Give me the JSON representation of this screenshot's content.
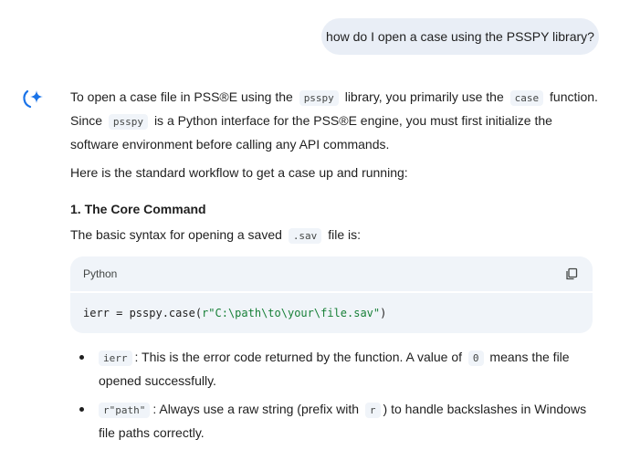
{
  "user_message": "how do I open a case using the PSSPY library?",
  "answer": {
    "intro": {
      "t1": "To open a case file in PSS®E using the",
      "c1": "psspy",
      "t2": "library, you primarily use the",
      "c2": "case",
      "t3": "function. Since",
      "c3": "psspy",
      "t4": "is a Python interface for the PSS®E engine, you must first initialize the software environment before calling any API commands."
    },
    "workflow": "Here is the standard workflow to get a case up and running:",
    "heading": "1. The Core Command",
    "syntax": {
      "t1": "The basic syntax for opening a saved",
      "c1": ".sav",
      "t2": "file is:"
    },
    "codeblock": {
      "language": "Python",
      "code_prefix": "ierr = psspy.case(",
      "code_string": "r\"C:\\path\\to\\your\\file.sav\"",
      "code_suffix": ")"
    },
    "bullets": [
      {
        "code": "ierr",
        "t1": ": This is the error code returned by the function. A value of",
        "code2": "0",
        "t2": "means the file opened successfully."
      },
      {
        "code": "r\"path\"",
        "t1": ": Always use a raw string (prefix with",
        "code2": "r",
        "t2": ") to handle backslashes in Windows file paths correctly."
      }
    ]
  },
  "colors": {
    "gemini_blue": "#1a73e8",
    "user_bubble_bg": "#e9eef6",
    "code_bg": "#f0f4f9"
  },
  "icons": {
    "assistant": "gemini-sparkle-icon",
    "copy": "copy-icon"
  }
}
